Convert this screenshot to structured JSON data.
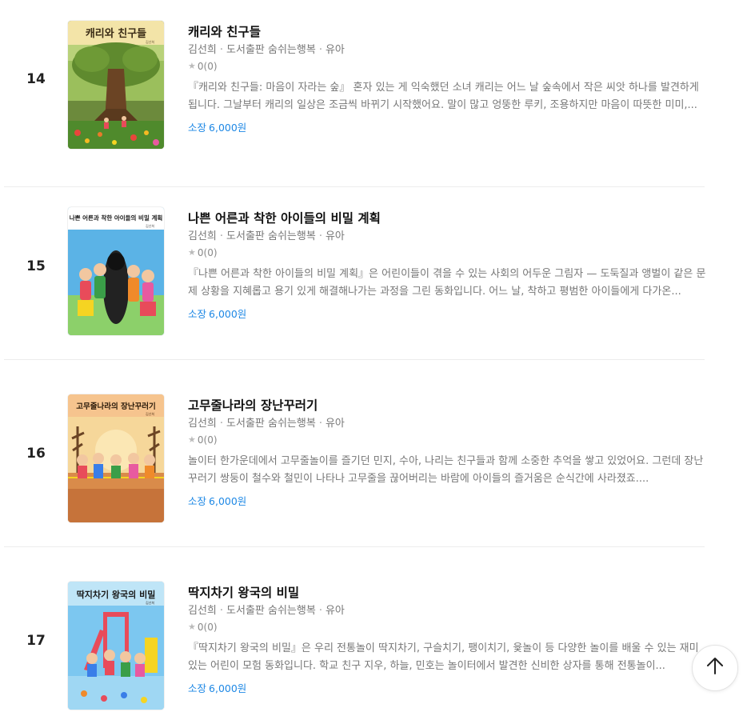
{
  "items": [
    {
      "rank": "14",
      "title": "캐리와 친구들",
      "author": "김선희",
      "publisher": "도서출판 숨쉬는행복",
      "category": "유아",
      "rating": "0",
      "rating_count": "(0)",
      "description": "『캐리와 친구들: 마음이 자라는 숲』 혼자 있는 게 익숙했던 소녀 캐리는 어느 날 숲속에서 작은 씨앗 하나를 발견하게 됩니다. 그날부터 캐리의 일상은 조금씩 바뀌기 시작했어요. 말이 많고 엉뚱한 루키, 조용하지만 마음이 따뜻한 미미,...",
      "price_label": "소장",
      "price": "6,000원",
      "cover_title": "캐리와 친구들",
      "cover_author": "김선희"
    },
    {
      "rank": "15",
      "title": "나쁜 어른과 착한 아이들의 비밀 계획",
      "author": "김선희",
      "publisher": "도서출판 숨쉬는행복",
      "category": "유아",
      "rating": "0",
      "rating_count": "(0)",
      "description": "『나쁜 어른과 착한 아이들의 비밀 계획』은 어린이들이 겪을 수 있는 사회의 어두운 그림자 — 도둑질과 앵벌이 같은 문제 상황을 지혜롭고 용기 있게 해결해나가는 과정을 그린 동화입니다. 어느 날, 착하고 평범한 아이들에게 다가온...",
      "price_label": "소장",
      "price": "6,000원",
      "cover_title": "나쁜 어른과 착한 아이들의 비밀 계획",
      "cover_author": "김선희"
    },
    {
      "rank": "16",
      "title": "고무줄나라의 장난꾸러기",
      "author": "김선희",
      "publisher": "도서출판 숨쉬는행복",
      "category": "유아",
      "rating": "0",
      "rating_count": "(0)",
      "description": "놀이터 한가운데에서 고무줄놀이를 즐기던 민지, 수아, 나리는 친구들과 함께 소중한 추억을 쌓고 있었어요. 그런데 장난꾸러기 쌍둥이 철수와 철민이 나타나 고무줄을 끊어버리는 바람에 아이들의 즐거움은 순식간에 사라졌죠....",
      "price_label": "소장",
      "price": "6,000원",
      "cover_title": "고무줄나라의 장난꾸러기",
      "cover_author": "김선희"
    },
    {
      "rank": "17",
      "title": "딱지차기 왕국의 비밀",
      "author": "김선희",
      "publisher": "도서출판 숨쉬는행복",
      "category": "유아",
      "rating": "0",
      "rating_count": "(0)",
      "description": "『딱지차기 왕국의 비밀』은 우리 전통놀이 딱지차기, 구슬치기, 팽이치기, 윷놀이 등 다양한 놀이를 배울 수 있는 재미있는 어린이 모험 동화입니다. 학교 친구 지우, 하늘, 민호는 놀이터에서 발견한 신비한 상자를 통해 전통놀이...",
      "price_label": "소장",
      "price": "6,000원",
      "cover_title": "딱지차기 왕국의 비밀",
      "cover_author": "김선희"
    }
  ],
  "colors": {
    "price": "#1e88e5",
    "rank": "#222222",
    "meta": "#777777"
  },
  "icons": {
    "star": "star-icon",
    "scroll_top": "arrow-up-icon"
  }
}
